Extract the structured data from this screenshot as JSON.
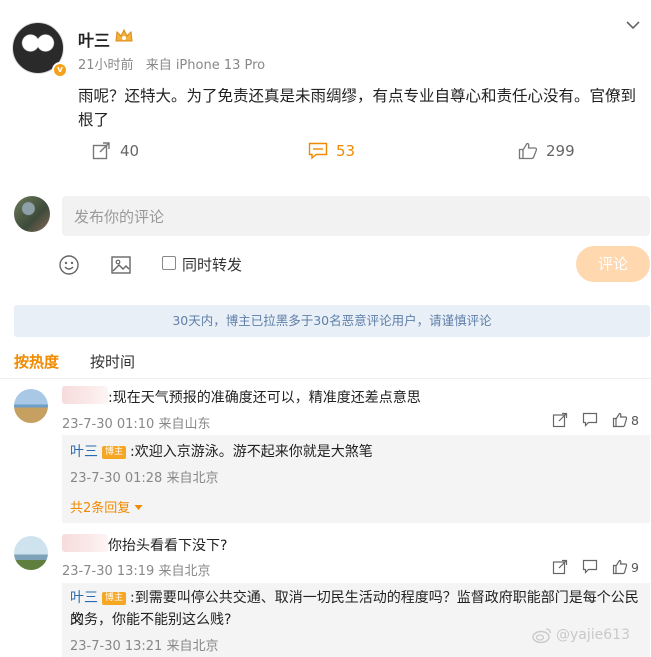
{
  "post": {
    "author": "叶三",
    "time": "21小时前",
    "source": "来自 iPhone 13 Pro",
    "text": "雨呢？还特大。为了免责还真是未雨绸缪，有点专业自尊心和责任心没有。官僚到根了",
    "badge": "v",
    "actions": {
      "repost_count": "40",
      "comment_count": "53",
      "like_count": "299"
    }
  },
  "composer": {
    "placeholder": "发布你的评论",
    "repost_label": "同时转发",
    "submit_label": "评论"
  },
  "notice": "30天内，博主已拉黑多于30名恶意评论用户，请谨慎评论",
  "tabs": {
    "hot": "按热度",
    "time": "按时间"
  },
  "comments": [
    {
      "text": ":现在天气预报的准确度还可以，精准度还差点意思",
      "time": "23-7-30 01:10",
      "location": "来自山东",
      "like_count": "8",
      "reply": {
        "author": "叶三",
        "tag": "博主",
        "text": ":欢迎入京游泳。游不起来你就是大煞笔",
        "time": "23-7-30 01:28",
        "location": "来自北京",
        "more": "共2条回复"
      }
    },
    {
      "text": "你抬头看看下没下?",
      "time": "23-7-30 13:19",
      "location": "来自北京",
      "like_count": "9",
      "reply": {
        "author": "叶三",
        "tag": "博主",
        "text_line1": ":到需要叫停公共交通、取消一切民生活动的程度吗？监督政府职能部门是每个公民的",
        "text_line2": "义务，你能不能别这么贱?",
        "time": "23-7-30 13:21",
        "location": "来自北京"
      }
    }
  ],
  "watermark": "@yajie613",
  "colors": {
    "accent": "#f08a00",
    "link": "#2b6cb0",
    "notice_bg": "#e8eff7"
  }
}
